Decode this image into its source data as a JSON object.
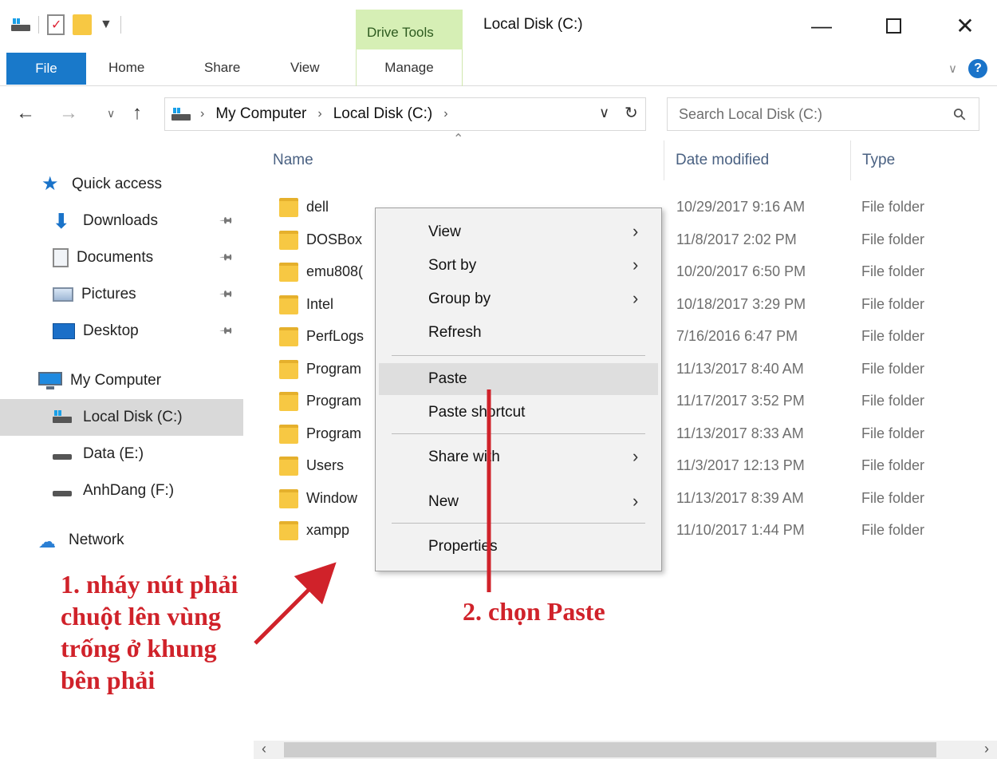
{
  "window": {
    "title": "Local Disk (C:)",
    "contextual_tab_group": "Drive Tools"
  },
  "ribbon": {
    "tabs": [
      "File",
      "Home",
      "Share",
      "View",
      "Manage"
    ]
  },
  "address": {
    "crumbs": [
      "My Computer",
      "Local Disk (C:)"
    ],
    "search_placeholder": "Search Local Disk (C:)"
  },
  "nav_pane": {
    "quick_access": "Quick access",
    "pinned": [
      "Downloads",
      "Documents",
      "Pictures",
      "Desktop"
    ],
    "this_pc": "My Computer",
    "drives": [
      "Local Disk (C:)",
      "Data (E:)",
      "AnhDang (F:)"
    ],
    "network": "Network",
    "selected": "Local Disk (C:)"
  },
  "columns": {
    "name": "Name",
    "date": "Date modified",
    "type": "Type"
  },
  "files": [
    {
      "name": "dell",
      "date": "10/29/2017 9:16 AM",
      "type": "File folder"
    },
    {
      "name": "DOSBox",
      "date": "11/8/2017 2:02 PM",
      "type": "File folder"
    },
    {
      "name": "emu808(",
      "date": "10/20/2017 6:50 PM",
      "type": "File folder"
    },
    {
      "name": "Intel",
      "date": "10/18/2017 3:29 PM",
      "type": "File folder"
    },
    {
      "name": "PerfLogs",
      "date": "7/16/2016 6:47 PM",
      "type": "File folder"
    },
    {
      "name": "Program",
      "date": "11/13/2017 8:40 AM",
      "type": "File folder"
    },
    {
      "name": "Program",
      "date": "11/17/2017 3:52 PM",
      "type": "File folder"
    },
    {
      "name": "Program",
      "date": "11/13/2017 8:33 AM",
      "type": "File folder"
    },
    {
      "name": "Users",
      "date": "11/3/2017 12:13 PM",
      "type": "File folder"
    },
    {
      "name": "Window",
      "date": "11/13/2017 8:39 AM",
      "type": "File folder"
    },
    {
      "name": "xampp",
      "date": "11/10/2017 1:44 PM",
      "type": "File folder"
    }
  ],
  "context_menu": {
    "items": [
      "View",
      "Sort by",
      "Group by",
      "Refresh",
      "Paste",
      "Paste shortcut",
      "Share with",
      "New",
      "Properties"
    ],
    "highlighted": "Paste"
  },
  "annotations": {
    "step1_lines": [
      "1. nháy nút phải",
      "chuột lên vùng",
      "trống ở khung",
      "bên phải"
    ],
    "step2": "2. chọn Paste",
    "color": "#d0222a"
  },
  "colors": {
    "file_tab": "#1979ca",
    "drive_tools": "#d6efb5",
    "folder": "#f7c843"
  }
}
